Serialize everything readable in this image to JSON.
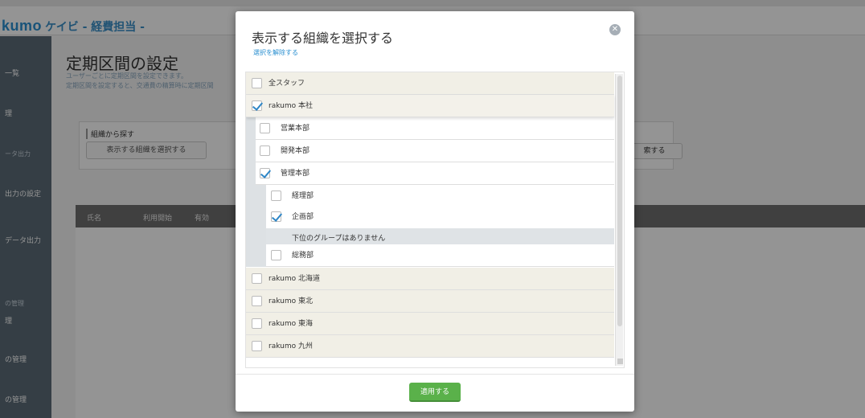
{
  "background": {
    "logo_text": "kumo",
    "org_text": "ケイビ - 経費担当 -",
    "page_title": "定期区間の設定",
    "page_desc_1": "ユーザーごとに定期区間を設定できます。",
    "page_desc_2": "定期区間を設定すると、交通費の精算時に定期区間",
    "panel_label": "組織から探す",
    "panel_button": "表示する組織を選択する",
    "panel_button2": "索する",
    "table_headers": [
      "氏名",
      "利用開始",
      "有効"
    ],
    "sidebar": [
      "一覧",
      "理",
      "ータ出力",
      "出力の設定",
      "データ出力",
      "の管理",
      "理",
      "の管理",
      "の管理"
    ]
  },
  "modal": {
    "title": "表示する組織を選択する",
    "close_icon": "close-icon",
    "clear_label": "選択を解除する",
    "no_groups_text": "下位のグループはありません",
    "apply_label": "適用する",
    "items": [
      {
        "label": "全スタッフ",
        "checked": false
      },
      {
        "label": "rakumo 本社",
        "checked": true
      },
      {
        "label": "営業本部",
        "checked": false
      },
      {
        "label": "開発本部",
        "checked": false
      },
      {
        "label": "管理本部",
        "checked": true
      },
      {
        "label": "経理部",
        "checked": false
      },
      {
        "label": "企画部",
        "checked": true
      },
      {
        "label": "総務部",
        "checked": false
      },
      {
        "label": "rakumo 北海道",
        "checked": false
      },
      {
        "label": "rakumo 東北",
        "checked": false
      },
      {
        "label": "rakumo 東海",
        "checked": false
      },
      {
        "label": "rakumo 九州",
        "checked": false
      }
    ]
  },
  "colors": {
    "accent": "#2a8fd0",
    "apply_button": "#5ab14a",
    "checkmark": "#2e86c6"
  }
}
